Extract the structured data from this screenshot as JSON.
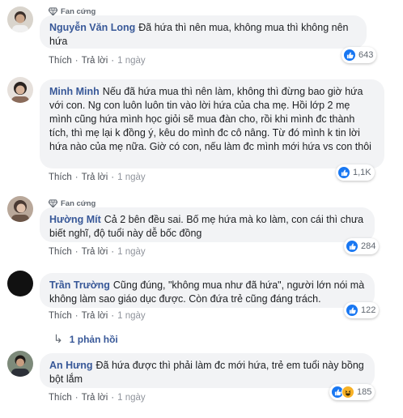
{
  "comments": [
    {
      "badge": "Fan cứng",
      "author": "Nguyễn Văn Long",
      "text": "Đã hứa thì nên mua, không mua thì không nên hứa",
      "like_label": "Thích",
      "reply_label": "Trả lời",
      "time": "1 ngày",
      "reaction_count": "643",
      "reactions": [
        "like-icon"
      ]
    },
    {
      "badge": "",
      "author": "Minh Minh",
      "text": "Nếu đã hứa mua thì nên làm, không thì đừng bao giờ hứa với con. Ng con luôn luôn tin vào lời hứa của cha mẹ. Hồi lớp 2 mẹ mình cũng hứa mình học giỏi sẽ mua đàn cho, rồi khi mình đc thành tích, thì mẹ lại k đồng ý, kêu do mình đc cô nâng. Từ đó mình k tin lời hứa nào của mẹ nữa. Giờ có con, nếu làm đc mình mới hứa vs con thôi",
      "like_label": "Thích",
      "reply_label": "Trả lời",
      "time": "1 ngày",
      "reaction_count": "1,1K",
      "reactions": [
        "like-icon"
      ]
    },
    {
      "badge": "Fan cứng",
      "author": "Hường Mít",
      "text": "Cả 2 bên đều sai. Bố mẹ hứa mà ko làm, con cái thì chưa biết nghĩ, độ tuổi này dễ bốc đồng",
      "like_label": "Thích",
      "reply_label": "Trả lời",
      "time": "1 ngày",
      "reaction_count": "284",
      "reactions": [
        "like-icon"
      ]
    },
    {
      "badge": "",
      "author": "Trần Trường",
      "text": "Cũng đúng, \"không mua như đã hứa\", người lớn nói mà không làm sao giáo dục được. Còn đứa trẻ cũng đáng trách.",
      "like_label": "Thích",
      "reply_label": "Trả lời",
      "time": "1 ngày",
      "reaction_count": "122",
      "reactions": [
        "like-icon"
      ],
      "replies_label": "1 phản hồi"
    },
    {
      "badge": "",
      "author": "An Hưng",
      "text": "Đã hứa được thì phải làm đc mới hứa, trẻ em tuổi này bồng bột lắm",
      "like_label": "Thích",
      "reply_label": "Trả lời",
      "time": "1 ngày",
      "reaction_count": "185",
      "reactions": [
        "like-icon",
        "haha-icon"
      ]
    }
  ],
  "colors": {
    "name": "#385898",
    "bubble": "#f2f3f5",
    "like": "#1877f2",
    "haha": "#f7b125",
    "meta": "#606770"
  }
}
